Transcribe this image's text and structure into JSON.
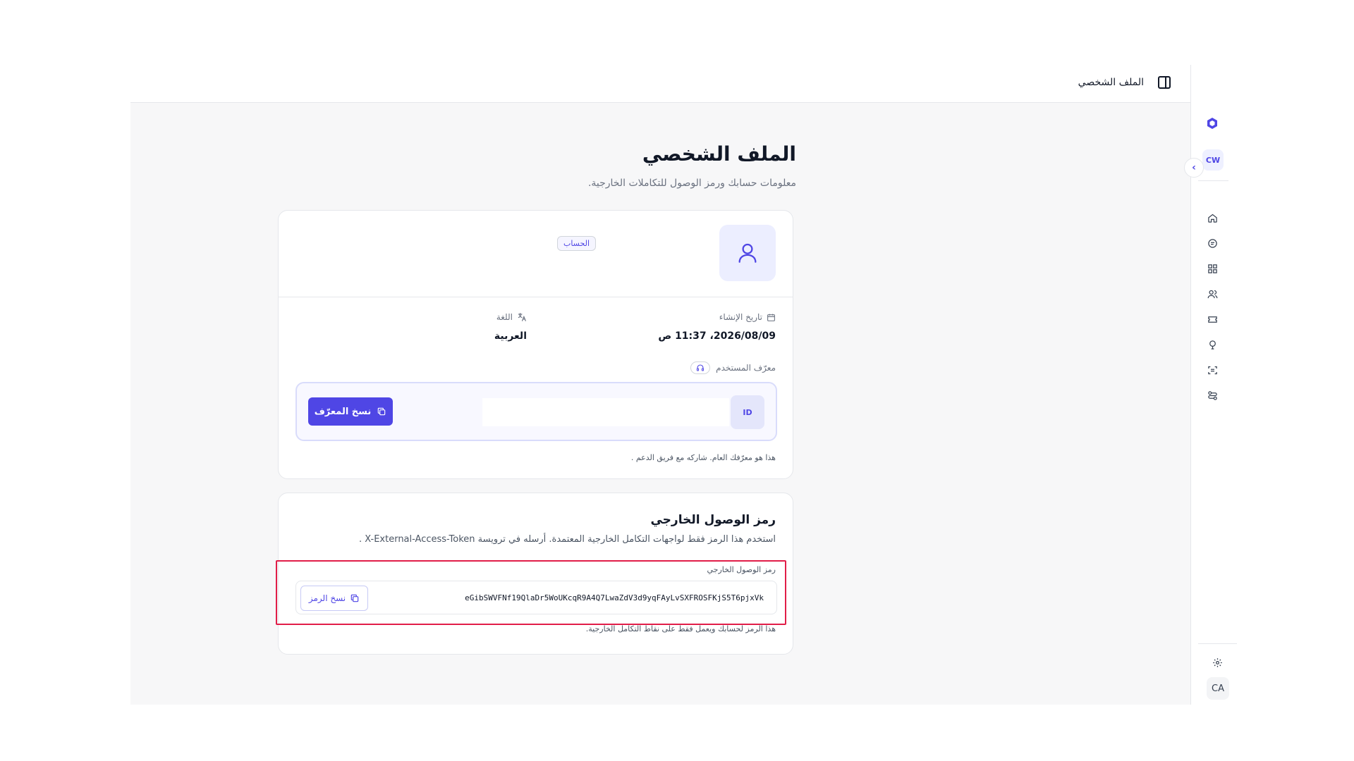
{
  "topbar": {
    "breadcrumb": "الملف الشخصي"
  },
  "page": {
    "title": "الملف الشخصي",
    "subtitle": "معلومات حسابك ورمز الوصول للتكاملات الخارجية."
  },
  "sidebar": {
    "workspace_badge": "CW",
    "user_initials": "CA",
    "items": [
      {
        "icon": "home-icon"
      },
      {
        "icon": "inbox-icon"
      },
      {
        "icon": "dashboard-icon"
      },
      {
        "icon": "contacts-icon"
      },
      {
        "icon": "tickets-icon"
      },
      {
        "icon": "help-icon"
      },
      {
        "icon": "scan-icon"
      },
      {
        "icon": "automation-icon"
      }
    ]
  },
  "account": {
    "badge": "الحساب",
    "created_label": "تاريخ الإنشاء",
    "created_value": "2026/08/09، 11:37 ص",
    "language_label": "اللغة",
    "language_value": "العربية",
    "user_id_label": "معرّف المستخدم",
    "id_tag": "ID",
    "id_value": "",
    "copy_id_label": "نسخ المعرّف",
    "id_hint": "هذا هو معرّفك العام. شاركه مع فريق الدعم ."
  },
  "token": {
    "title": "رمز الوصول الخارجي",
    "description": "استخدم هذا الرمز فقط لواجهات التكامل الخارجية المعتمدة. أرسله في ترويسة X-External-Access-Token .",
    "field_label": "رمز الوصول الخارجي",
    "value": "eGibSWVFNf19QlaDr5WoUKcqR9A4Q7LwaZdV3d9yqFAyLvSXFROSFKjS5T6pjxVk",
    "copy_label": "نسخ الرمز",
    "hint": "هذا الرمز لحسابك ويعمل فقط على نقاط التكامل الخارجية."
  },
  "colors": {
    "accent": "#4f46e5",
    "highlight": "#e11d48"
  }
}
